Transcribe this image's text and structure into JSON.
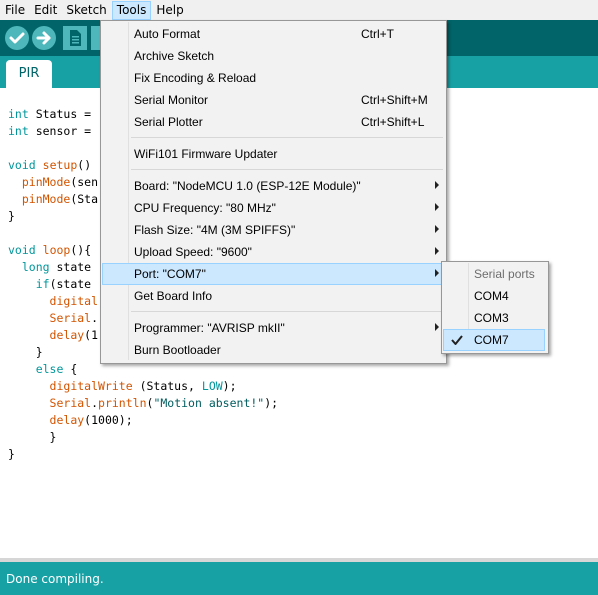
{
  "menubar": {
    "file": "File",
    "edit": "Edit",
    "sketch": "Sketch",
    "tools": "Tools",
    "help": "Help"
  },
  "tabs": [
    {
      "label": "PIR"
    }
  ],
  "code": [
    [
      [
        "kw",
        "int"
      ],
      [
        "p",
        " Status = "
      ]
    ],
    [
      [
        "kw",
        "int"
      ],
      [
        "p",
        " sensor = "
      ]
    ],
    [
      [
        "p",
        ""
      ]
    ],
    [
      [
        "kw",
        "void"
      ],
      [
        "p",
        " "
      ],
      [
        "fn",
        "setup"
      ],
      [
        "p",
        "()"
      ]
    ],
    [
      [
        "p",
        "  "
      ],
      [
        "fn",
        "pinMode"
      ],
      [
        "p",
        "(sen"
      ]
    ],
    [
      [
        "p",
        "  "
      ],
      [
        "fn",
        "pinMode"
      ],
      [
        "p",
        "(Sta"
      ]
    ],
    [
      [
        "p",
        "}"
      ]
    ],
    [
      [
        "p",
        ""
      ]
    ],
    [
      [
        "kw",
        "void"
      ],
      [
        "p",
        " "
      ],
      [
        "fn",
        "loop"
      ],
      [
        "p",
        "(){"
      ]
    ],
    [
      [
        "p",
        "  "
      ],
      [
        "kw",
        "long"
      ],
      [
        "p",
        " state"
      ]
    ],
    [
      [
        "p",
        "    "
      ],
      [
        "kw",
        "if"
      ],
      [
        "p",
        "(state"
      ]
    ],
    [
      [
        "p",
        "      "
      ],
      [
        "fn",
        "digital"
      ]
    ],
    [
      [
        "p",
        "      "
      ],
      [
        "fn",
        "Serial"
      ],
      [
        "p",
        "."
      ]
    ],
    [
      [
        "p",
        "      "
      ],
      [
        "fn",
        "delay"
      ],
      [
        "p",
        "(1"
      ]
    ],
    [
      [
        "p",
        "    }"
      ]
    ],
    [
      [
        "p",
        "    "
      ],
      [
        "kw",
        "else"
      ],
      [
        "p",
        " {"
      ]
    ],
    [
      [
        "p",
        "      "
      ],
      [
        "fn",
        "digitalWrite"
      ],
      [
        "p",
        " (Status, "
      ],
      [
        "cst",
        "LOW"
      ],
      [
        "p",
        ");"
      ]
    ],
    [
      [
        "p",
        "      "
      ],
      [
        "fn",
        "Serial"
      ],
      [
        "p",
        "."
      ],
      [
        "fn",
        "println"
      ],
      [
        "p",
        "("
      ],
      [
        "str",
        "\"Motion absent!\""
      ],
      [
        "p",
        ");"
      ]
    ],
    [
      [
        "p",
        "      "
      ],
      [
        "fn",
        "delay"
      ],
      [
        "p",
        "(1000);"
      ]
    ],
    [
      [
        "p",
        "      }"
      ]
    ],
    [
      [
        "p",
        "}"
      ]
    ]
  ],
  "tools_menu": {
    "auto_format": "Auto Format",
    "auto_format_shortcut": "Ctrl+T",
    "archive_sketch": "Archive Sketch",
    "fix_encoding": "Fix Encoding & Reload",
    "serial_monitor": "Serial Monitor",
    "serial_monitor_shortcut": "Ctrl+Shift+M",
    "serial_plotter": "Serial Plotter",
    "serial_plotter_shortcut": "Ctrl+Shift+L",
    "wifi_updater": "WiFi101 Firmware Updater",
    "board": "Board: \"NodeMCU 1.0 (ESP-12E Module)\"",
    "cpu_frequency": "CPU Frequency: \"80 MHz\"",
    "flash_size": "Flash Size: \"4M (3M SPIFFS)\"",
    "upload_speed": "Upload Speed: \"9600\"",
    "port": "Port: \"COM7\"",
    "get_board_info": "Get Board Info",
    "programmer": "Programmer: \"AVRISP mkII\"",
    "burn_bootloader": "Burn Bootloader"
  },
  "port_submenu": {
    "header": "Serial ports",
    "items": [
      "COM4",
      "COM3",
      "COM7"
    ],
    "selected": "COM7"
  },
  "status": {
    "message": "Done compiling."
  },
  "icons": {
    "verify": "check-icon",
    "upload": "arrow-right-icon",
    "new": "new-file-icon",
    "checkmark": "checkmark-icon",
    "submenu_arrow": "chevron-right-icon"
  },
  "colors": {
    "toolbar": "#006468",
    "tabbar": "#17a1a5",
    "status_bar": "#17a1a5",
    "button": "#4db7bb",
    "keyword": "#00979c",
    "function": "#d35400"
  }
}
